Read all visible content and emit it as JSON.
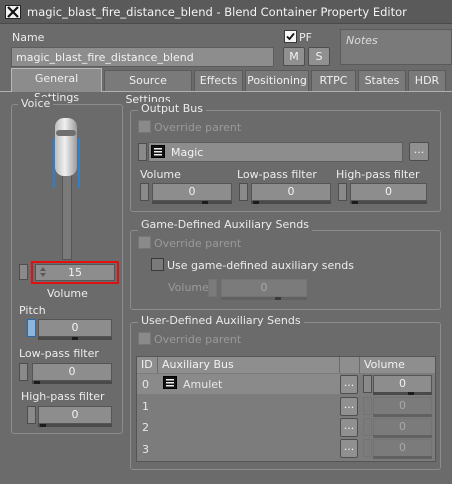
{
  "window": {
    "title": "magic_blast_fire_distance_blend - Blend Container Property Editor"
  },
  "header": {
    "name_label": "Name",
    "name_value": "magic_blast_fire_distance_blend",
    "pf_label": "PF",
    "m_label": "M",
    "s_label": "S",
    "notes_placeholder": "Notes"
  },
  "tabs": [
    {
      "label": "General Settings",
      "active": true
    },
    {
      "label": "Source Settings"
    },
    {
      "label": "Effects"
    },
    {
      "label": "Positioning"
    },
    {
      "label": "RTPC"
    },
    {
      "label": "States"
    },
    {
      "label": "HDR"
    }
  ],
  "voice": {
    "group_title": "Voice",
    "volume_value": "15",
    "volume_label": "Volume",
    "pitch_label": "Pitch",
    "pitch_value": "0",
    "lowpass_label": "Low-pass filter",
    "lowpass_value": "0",
    "highpass_label": "High-pass filter",
    "highpass_value": "0",
    "highlight_color": "#e01010"
  },
  "output_bus": {
    "group_title": "Output Bus",
    "override_label": "Override parent",
    "bus_name": "Magic",
    "browse_label": "...",
    "volume_label": "Volume",
    "volume_value": "0",
    "lowpass_label": "Low-pass filter",
    "lowpass_value": "0",
    "highpass_label": "High-pass filter",
    "highpass_value": "0"
  },
  "game_aux": {
    "group_title": "Game-Defined Auxiliary Sends",
    "override_label": "Override parent",
    "use_label": "Use game-defined auxiliary sends",
    "volume_label": "Volume",
    "volume_value": "0"
  },
  "user_aux": {
    "group_title": "User-Defined Auxiliary Sends",
    "override_label": "Override parent",
    "columns": [
      "ID",
      "Auxiliary Bus",
      "Volume"
    ],
    "rows": [
      {
        "id": "0",
        "bus": "Amulet",
        "browse": "...",
        "volume": "0"
      },
      {
        "id": "1",
        "bus": "",
        "browse": "...",
        "volume": "0"
      },
      {
        "id": "2",
        "bus": "",
        "browse": "...",
        "volume": "0"
      },
      {
        "id": "3",
        "bus": "",
        "browse": "...",
        "volume": "0"
      }
    ]
  }
}
